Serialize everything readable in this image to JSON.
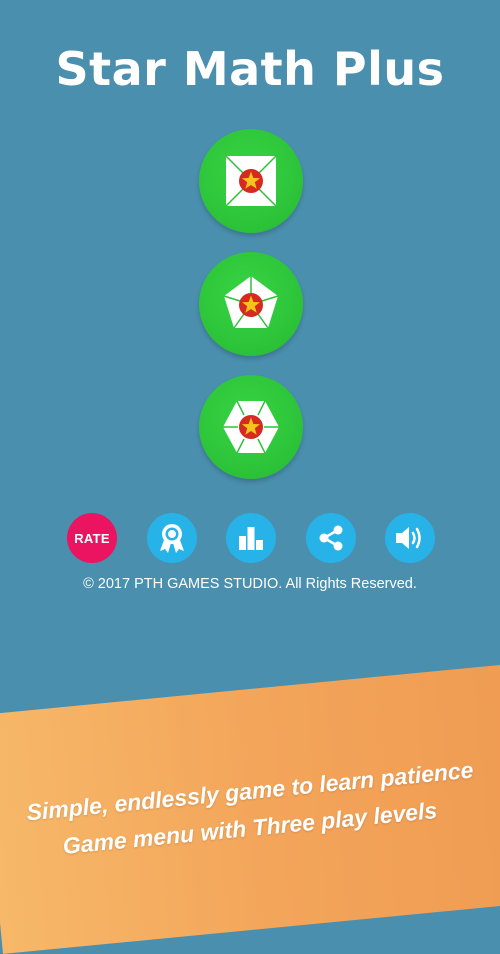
{
  "app": {
    "title": "Star Math Plus"
  },
  "levels": [
    {
      "name": "level-1",
      "icon": "square-star-icon"
    },
    {
      "name": "level-2",
      "icon": "pentagon-star-icon"
    },
    {
      "name": "level-3",
      "icon": "hexagon-star-icon"
    }
  ],
  "toolbar": {
    "rate_label": "RATE",
    "icons": [
      "award-icon",
      "leaderboard-icon",
      "share-icon",
      "sound-icon"
    ]
  },
  "footer": {
    "copyright": "© 2017 PTH GAMES STUDIO. All Rights Reserved."
  },
  "promo": {
    "line1": "Simple, endlessly game to learn patience",
    "line2": "Game menu with Three play levels"
  },
  "colors": {
    "background": "#4a8fae",
    "level_button": "#2cc238",
    "icon_button": "#28b3e8",
    "rate_button": "#ea1461",
    "banner": "#f3a55a",
    "star": "#f6c21b",
    "star_circle": "#d42a20"
  }
}
